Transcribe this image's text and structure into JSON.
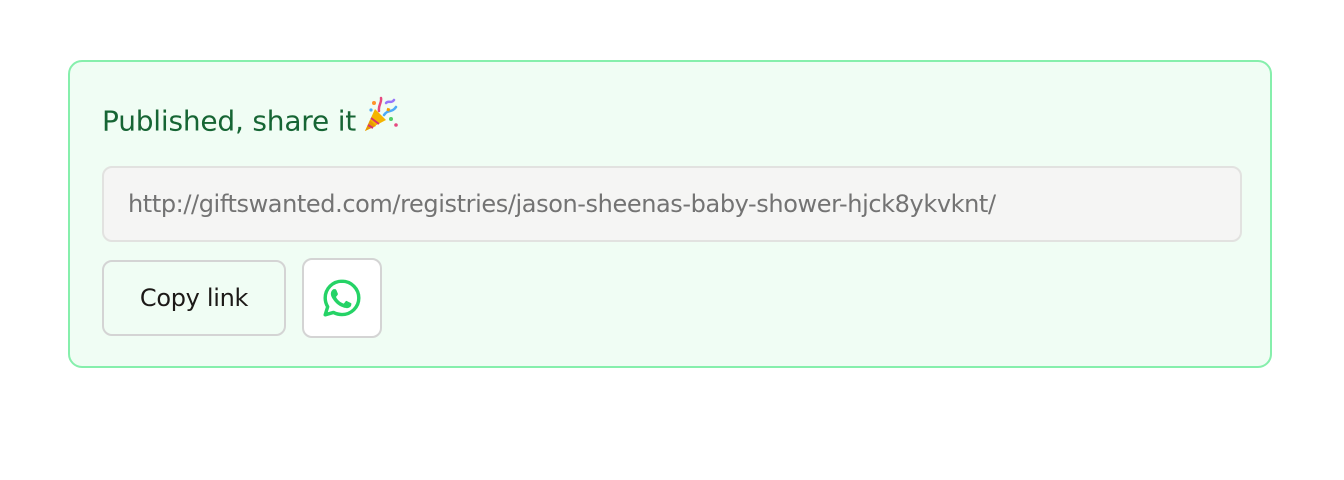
{
  "share_card": {
    "title": "Published, share it",
    "title_icon": "party-popper-icon",
    "url": "http://giftswanted.com/registries/jason-sheenas-baby-shower-hjck8ykvknt/",
    "copy_button_label": "Copy link",
    "share_button_icon": "whatsapp-icon"
  },
  "colors": {
    "card_background": "#f0fdf4",
    "card_border": "#86efac",
    "title_text": "#166534",
    "url_text": "#737373",
    "url_background": "#f5f5f4",
    "whatsapp_green": "#25d366"
  }
}
